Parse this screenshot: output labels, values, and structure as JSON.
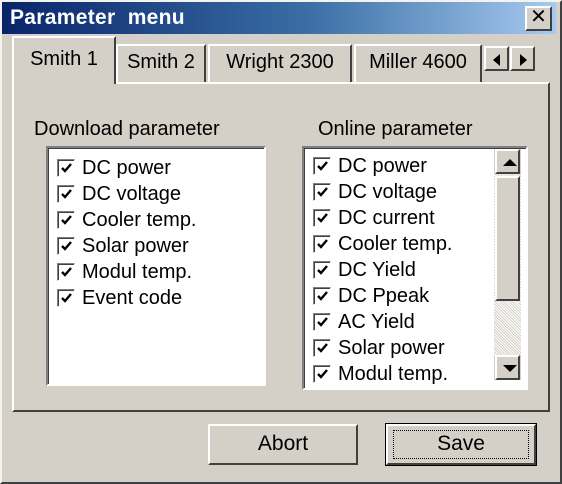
{
  "window": {
    "title": "Parameter  menu",
    "close_glyph": "✕"
  },
  "tabs": [
    {
      "label": "Smith 1",
      "active": true
    },
    {
      "label": "Smith 2",
      "active": false
    },
    {
      "label": "Wright  2300",
      "active": false
    },
    {
      "label": "Miller 4600",
      "active": false
    }
  ],
  "tab_scroll": {
    "left_icon": "arrow-left-icon",
    "right_icon": "arrow-right-icon"
  },
  "download": {
    "label": "Download parameter",
    "items": [
      {
        "label": "DC power",
        "checked": true
      },
      {
        "label": "DC voltage",
        "checked": true
      },
      {
        "label": "Cooler temp.",
        "checked": true
      },
      {
        "label": "Solar power",
        "checked": true
      },
      {
        "label": "Modul temp.",
        "checked": true
      },
      {
        "label": "Event code",
        "checked": true
      }
    ]
  },
  "online": {
    "label": "Online parameter",
    "items": [
      {
        "label": "DC power",
        "checked": true
      },
      {
        "label": "DC voltage",
        "checked": true
      },
      {
        "label": "DC current",
        "checked": true
      },
      {
        "label": "Cooler temp.",
        "checked": true
      },
      {
        "label": "DC Yield",
        "checked": true
      },
      {
        "label": "DC Ppeak",
        "checked": true
      },
      {
        "label": "AC Yield",
        "checked": true
      },
      {
        "label": "Solar power",
        "checked": true
      },
      {
        "label": "Modul temp.",
        "checked": true
      }
    ]
  },
  "buttons": {
    "abort_label": "Abort",
    "save_label": "Save"
  },
  "colors": {
    "face": "#d4d0c8",
    "title_start": "#0a246a",
    "title_end": "#a6caf0",
    "list_bg": "#ffffff"
  }
}
